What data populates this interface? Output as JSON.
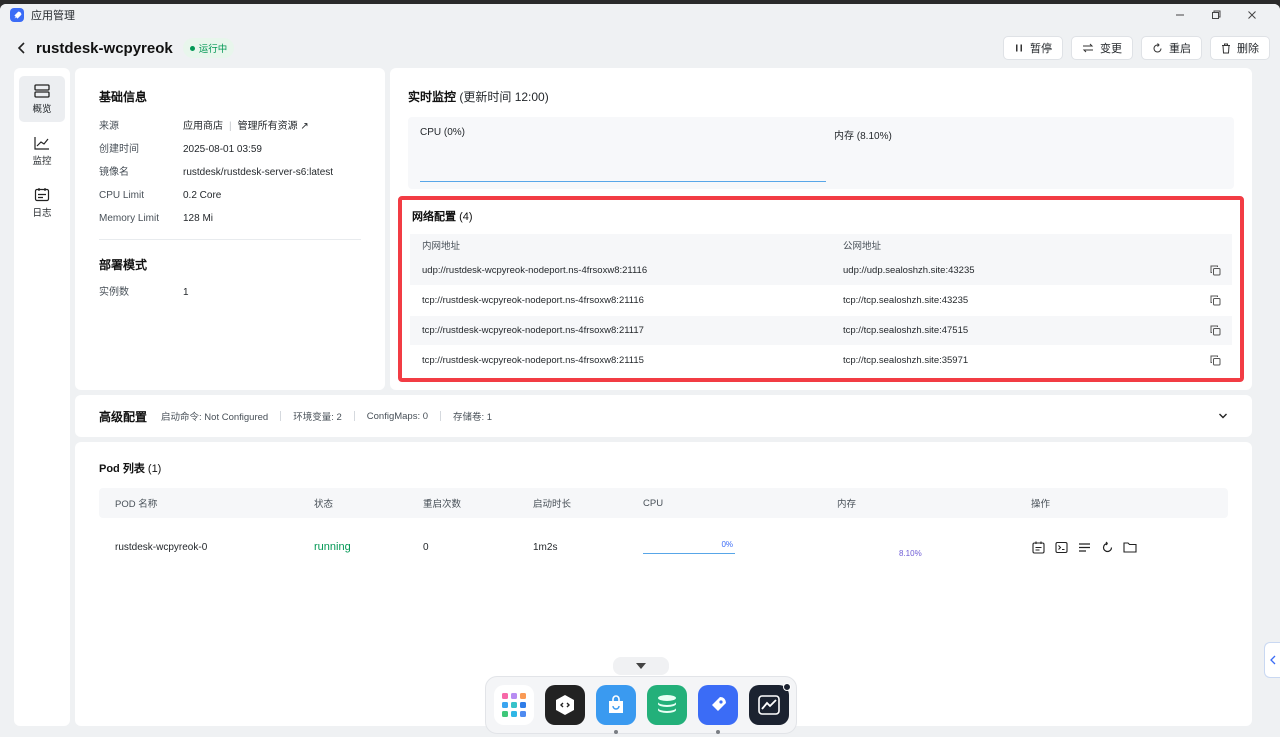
{
  "window": {
    "title": "应用管理"
  },
  "header": {
    "app_name": "rustdesk-wcpyreok",
    "status_badge": "运行中"
  },
  "actions": {
    "pause": "暂停",
    "change": "变更",
    "restart": "重启",
    "delete": "删除"
  },
  "sidenav": {
    "items": [
      {
        "label": "概览"
      },
      {
        "label": "监控"
      },
      {
        "label": "日志"
      }
    ]
  },
  "basic_info": {
    "title": "基础信息",
    "source_label": "来源",
    "source_value": "应用商店",
    "source_link": "管理所有资源 ↗",
    "created_label": "创建时间",
    "created_value": "2025-08-01 03:59",
    "image_label": "镜像名",
    "image_value": "rustdesk/rustdesk-server-s6:latest",
    "cpu_label": "CPU Limit",
    "cpu_value": "0.2 Core",
    "memory_label": "Memory Limit",
    "memory_value": "128 Mi"
  },
  "deploy_mode": {
    "title": "部署模式",
    "instances_label": "实例数",
    "instances_value": "1"
  },
  "monitor": {
    "title": "实时监控",
    "update_time": "(更新时间 12:00)",
    "cpu": "CPU (0%)",
    "memory": "内存 (8.10%)"
  },
  "network": {
    "title": "网络配置",
    "count": "(4)",
    "columns": [
      "内网地址",
      "公网地址"
    ],
    "rows": [
      {
        "internal": "udp://rustdesk-wcpyreok-nodeport.ns-4frsoxw8:21116",
        "public": "udp://udp.sealoshzh.site:43235"
      },
      {
        "internal": "tcp://rustdesk-wcpyreok-nodeport.ns-4frsoxw8:21116",
        "public": "tcp://tcp.sealoshzh.site:43235"
      },
      {
        "internal": "tcp://rustdesk-wcpyreok-nodeport.ns-4frsoxw8:21117",
        "public": "tcp://tcp.sealoshzh.site:47515"
      },
      {
        "internal": "tcp://rustdesk-wcpyreok-nodeport.ns-4frsoxw8:21115",
        "public": "tcp://tcp.sealoshzh.site:35971"
      }
    ]
  },
  "advanced": {
    "title": "高级配置",
    "startup_cmd": "启动命令: Not Configured",
    "env_vars": "环境变量: 2",
    "configmaps": "ConfigMaps: 0",
    "storage": "存储卷: 1"
  },
  "pods": {
    "title": "Pod 列表",
    "count": "(1)",
    "columns": [
      "POD 名称",
      "状态",
      "重启次数",
      "启动时长",
      "CPU",
      "内存",
      "操作"
    ],
    "rows": [
      {
        "name": "rustdesk-wcpyreok-0",
        "status": "running",
        "restarts": "0",
        "uptime": "1m2s",
        "cpu": "0%",
        "memory": "8.10%"
      }
    ]
  },
  "colors": {
    "accent": "#3b6cf6",
    "running": "#039855",
    "highlight": "#f23c44"
  }
}
